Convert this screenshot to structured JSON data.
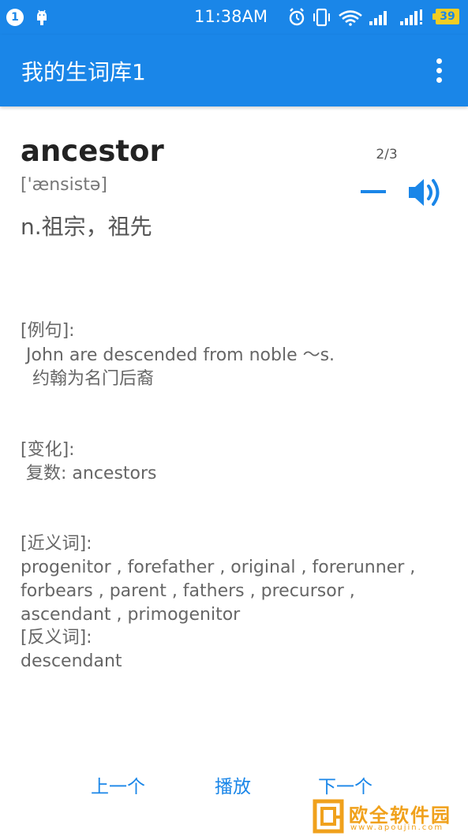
{
  "status_bar": {
    "notification_count": "1",
    "time": "11:38AM",
    "battery": "39",
    "icons": [
      "android-icon",
      "alarm-icon",
      "vibrate-icon",
      "wifi-icon",
      "signal-icon",
      "signal-icon"
    ]
  },
  "app_bar": {
    "title": "我的生词库1",
    "menu_icon": "more-vert-icon"
  },
  "card": {
    "word": "ancestor",
    "counter": "2/3",
    "phonetic": "['ænsistə]",
    "meaning": "n.祖宗，祖先",
    "example_label": "[例句]:",
    "example_en": "John are descended from noble ～s.",
    "example_cn": "约翰为名门后裔",
    "variation_label": "[变化]:",
    "variation_value": "复数: ancestors",
    "synonyms_label": "[近义词]:",
    "synonyms_value": "progenitor , forefather , original , forerunner , forbears , parent , fathers , precursor , ascendant , primogenitor",
    "antonyms_label": "[反义词]:",
    "antonyms_value": "descendant"
  },
  "controls": {
    "prev": "上一个",
    "play": "播放",
    "next": "下一个"
  },
  "watermark": {
    "text": "欧全软件园",
    "url": "www.apoujin.com"
  },
  "colors": {
    "primary": "#1a86e8",
    "battery": "#f2cd23",
    "watermark": "#f0a11c"
  }
}
